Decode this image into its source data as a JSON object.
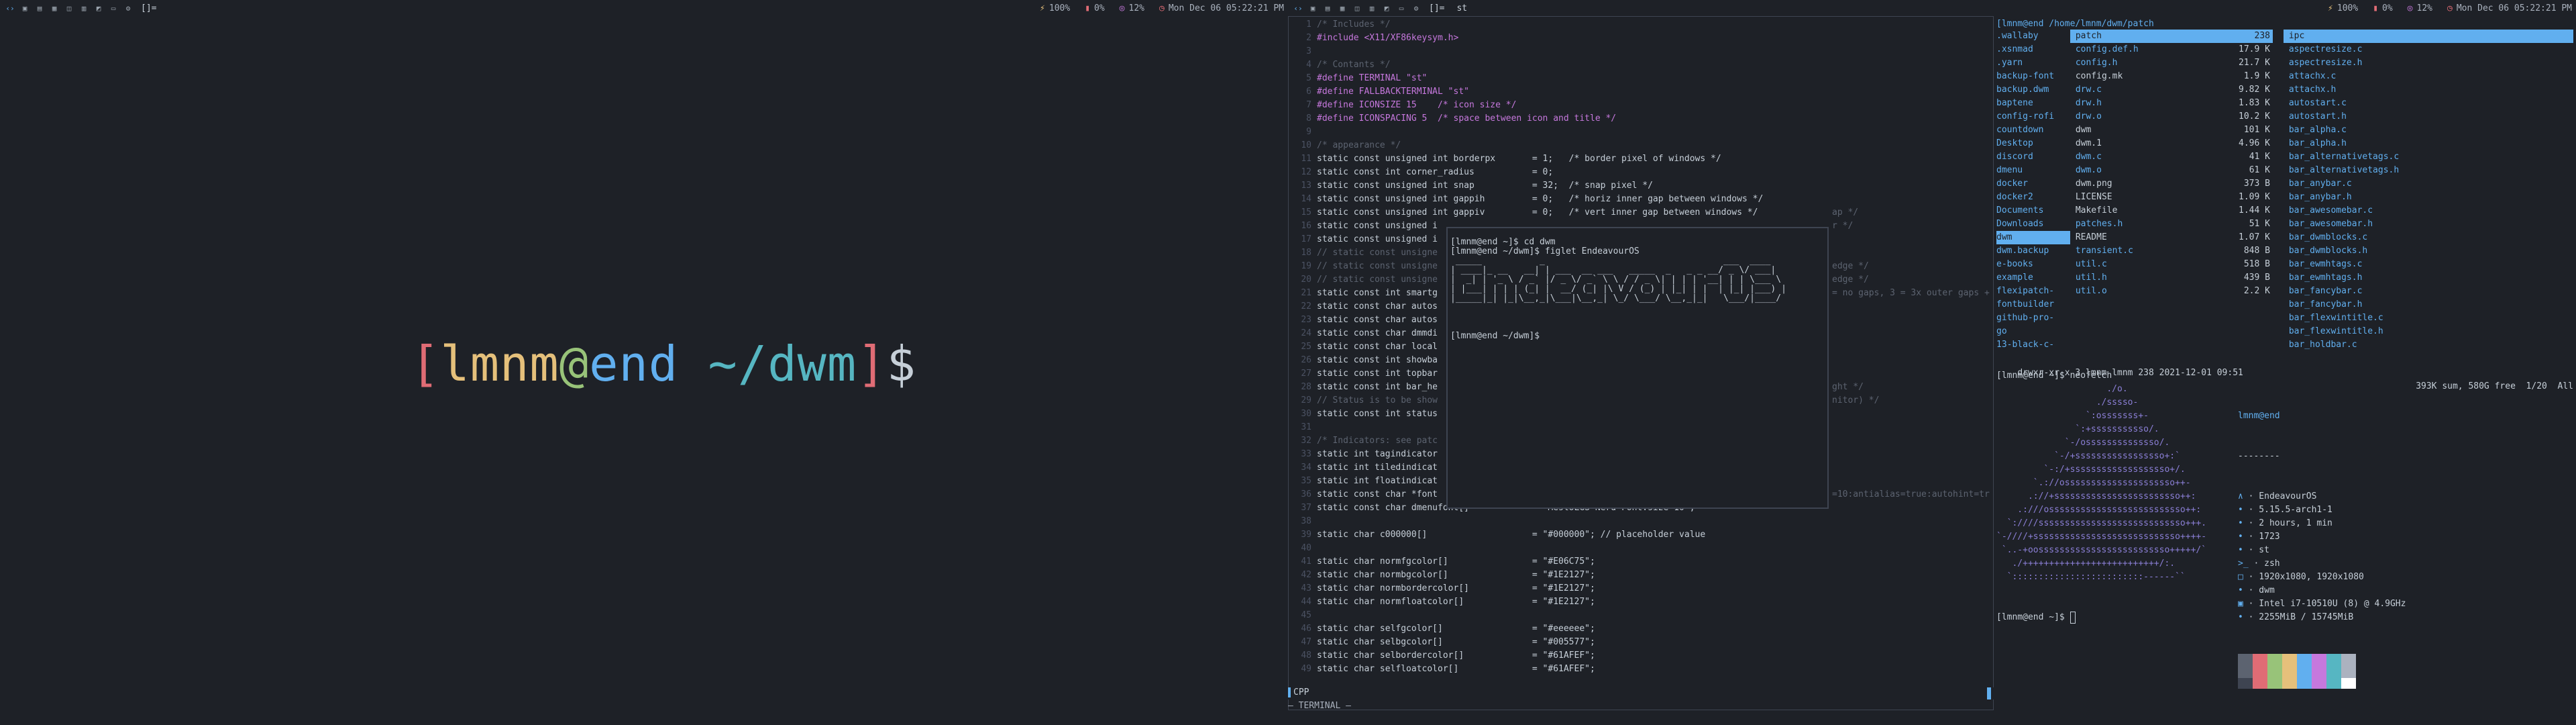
{
  "bar_left": {
    "layout": "[]=",
    "battery": "100%",
    "cpu": "0%",
    "mem": "12%",
    "clock": "Mon Dec 06 05:22:21 PM"
  },
  "bar_right": {
    "layout": "[]=",
    "title": "st",
    "battery": "100%",
    "cpu": "0%",
    "mem": "12%",
    "clock": "Mon Dec 06 05:22:21 PM"
  },
  "left_prompt": {
    "open": "[",
    "user": "lmnm",
    "at": "@",
    "host": "end",
    "path": "~/dwm",
    "close": "]",
    "sign": "$"
  },
  "editor": {
    "lines": [
      {
        "n": "1",
        "t": "/* Includes */",
        "k": "dim"
      },
      {
        "n": "2",
        "t": "#include <X11/XF86keysym.h>",
        "k": "m"
      },
      {
        "n": "3",
        "t": "",
        "k": "w"
      },
      {
        "n": "4",
        "t": "/* Contants */",
        "k": "dim"
      },
      {
        "n": "5",
        "t": "#define TERMINAL \"st\"",
        "k": "m"
      },
      {
        "n": "6",
        "t": "#define FALLBACKTERMINAL \"st\"",
        "k": "m"
      },
      {
        "n": "7",
        "t": "#define ICONSIZE 15    /* icon size */",
        "k": "m"
      },
      {
        "n": "8",
        "t": "#define ICONSPACING 5  /* space between icon and title */",
        "k": "m"
      },
      {
        "n": "9",
        "t": "",
        "k": "w"
      },
      {
        "n": "10",
        "t": "/* appearance */",
        "k": "dim"
      },
      {
        "n": "11",
        "t": "static const unsigned int borderpx       = 1;   /* border pixel of windows */",
        "k": "w"
      },
      {
        "n": "12",
        "t": "static const int corner_radius           = 0;",
        "k": "w"
      },
      {
        "n": "13",
        "t": "static const unsigned int snap           = 32;  /* snap pixel */",
        "k": "w"
      },
      {
        "n": "14",
        "t": "static const unsigned int gappih         = 0;   /* horiz inner gap between windows */",
        "k": "w"
      },
      {
        "n": "15",
        "t": "static const unsigned int gappiv         = 0;   /* vert inner gap between windows */",
        "k": "w"
      },
      {
        "n": "16",
        "t": "static const unsigned i",
        "k": "w"
      },
      {
        "n": "17",
        "t": "static const unsigned i",
        "k": "w"
      },
      {
        "n": "18",
        "t": "// static const unsigne",
        "k": "dim"
      },
      {
        "n": "19",
        "t": "// static const unsigne",
        "k": "dim"
      },
      {
        "n": "20",
        "t": "// static const unsigne",
        "k": "dim"
      },
      {
        "n": "21",
        "t": "static const int smartg",
        "k": "w"
      },
      {
        "n": "22",
        "t": "static const char autos",
        "k": "w"
      },
      {
        "n": "23",
        "t": "static const char autos",
        "k": "w"
      },
      {
        "n": "24",
        "t": "static const char dmmdi",
        "k": "w"
      },
      {
        "n": "25",
        "t": "static const char local",
        "k": "w"
      },
      {
        "n": "26",
        "t": "static const int showba",
        "k": "w"
      },
      {
        "n": "27",
        "t": "static const int topbar",
        "k": "w"
      },
      {
        "n": "28",
        "t": "static const int bar_he",
        "k": "w"
      },
      {
        "n": "29",
        "t": "// Status is to be show",
        "k": "dim"
      },
      {
        "n": "30",
        "t": "static const int status",
        "k": "w"
      },
      {
        "n": "31",
        "t": "",
        "k": "w"
      },
      {
        "n": "32",
        "t": "/* Indicators: see patc",
        "k": "dim"
      },
      {
        "n": "33",
        "t": "static int tagindicator",
        "k": "w"
      },
      {
        "n": "34",
        "t": "static int tiledindicat",
        "k": "w"
      },
      {
        "n": "35",
        "t": "static int floatindicat",
        "k": "w"
      },
      {
        "n": "36",
        "t": "static const char *font",
        "k": "w"
      },
      {
        "n": "37",
        "t": "static const char dmenufont[]            = \"MesloLGS Nerd Font:size=10\";",
        "k": "w"
      },
      {
        "n": "38",
        "t": "",
        "k": "w"
      },
      {
        "n": "39",
        "t": "static char c000000[]                    = \"#000000\"; // placeholder value",
        "k": "w"
      },
      {
        "n": "40",
        "t": "",
        "k": "w"
      },
      {
        "n": "41",
        "t": "static char normfgcolor[]                = \"#E06C75\";",
        "k": "w"
      },
      {
        "n": "42",
        "t": "static char normbgcolor[]                = \"#1E2127\";",
        "k": "w"
      },
      {
        "n": "43",
        "t": "static char normbordercolor[]            = \"#1E2127\";",
        "k": "w"
      },
      {
        "n": "44",
        "t": "static char normfloatcolor[]             = \"#1E2127\";",
        "k": "w"
      },
      {
        "n": "45",
        "t": "",
        "k": "w"
      },
      {
        "n": "46",
        "t": "static char selfgcolor[]                 = \"#eeeeee\";",
        "k": "w"
      },
      {
        "n": "47",
        "t": "static char selbgcolor[]                 = \"#005577\";",
        "k": "w"
      },
      {
        "n": "48",
        "t": "static char selbordercolor[]             = \"#61AFEF\";",
        "k": "w"
      },
      {
        "n": "49",
        "t": "static char selfloatcolor[]              = \"#61AFEF\";",
        "k": "w"
      }
    ],
    "overflow_right": [
      {
        "row": 15,
        "t": "ap */"
      },
      {
        "row": 16,
        "t": "r */"
      },
      {
        "row": 19,
        "t": "edge */"
      },
      {
        "row": 20,
        "t": "edge */"
      },
      {
        "row": 21,
        "t": "= no gaps, 3 = 3x outer gaps +"
      },
      {
        "row": 28,
        "t": "ght */"
      },
      {
        "row": 29,
        "t": "nitor) */"
      },
      {
        "row": 36,
        "t": "=10:antialias=true:autohint=tr"
      }
    ],
    "mode": "CPP",
    "terminal_label": "— TERMINAL —"
  },
  "float_term": {
    "lines": [
      "[lmnm@end ~]$ cd dwm",
      "[lmnm@end ~/dwm]$ figlet EndeavourOS",
      " _____           _                                  ___  ____  ",
      "| ____|_ __   __| | ___  __ ___   _____  _   _ _ __/ _ \\/ ___| ",
      "|  _| | '_ \\ / _` |/ _ \\/ _` \\ \\ / / _ \\| | | | '__| | | \\___ \\ ",
      "| |___| | | | (_| |  __/ (_| |\\ V / (_) | |_| | |  | |_| |___) |",
      "|_____|_| |_|\\__,_|\\___|\\__,_| \\_/ \\___/ \\__,_|_|   \\___/|____/ ",
      "",
      "[lmnm@end ~/dwm]$ "
    ]
  },
  "filemgr": {
    "path": "[lmnm@end /home/lmnm/dwm/patch",
    "col1": [
      ".wallaby",
      ".xsnmad",
      ".yarn",
      "backup-font",
      "backup.dwm",
      "baptene",
      "config-rofi",
      "countdown",
      "Desktop",
      "discord",
      "dmenu",
      "docker",
      "docker2",
      "Documents",
      "Downloads",
      "dwm",
      "dwm.backup",
      "e-books",
      "example",
      "flexipatch-",
      "fontbuilder",
      "github-pro-",
      "go",
      "13-black-c-"
    ],
    "col2": [
      {
        "name": "patch",
        "size": "238"
      },
      {
        "name": "config.def.h",
        "size": "17.9 K"
      },
      {
        "name": "config.h",
        "size": "21.7 K"
      },
      {
        "name": "config.mk",
        "size": "1.9 K"
      },
      {
        "name": "drw.c",
        "size": "9.82 K"
      },
      {
        "name": "drw.h",
        "size": "1.83 K"
      },
      {
        "name": "drw.o",
        "size": "10.2 K"
      },
      {
        "name": "dwm",
        "size": "101 K"
      },
      {
        "name": "dwm.1",
        "size": "4.96 K"
      },
      {
        "name": "dwm.c",
        "size": "41 K"
      },
      {
        "name": "dwm.o",
        "size": "61 K"
      },
      {
        "name": "dwm.png",
        "size": "373 B"
      },
      {
        "name": "LICENSE",
        "size": "1.09 K"
      },
      {
        "name": "Makefile",
        "size": "1.44 K"
      },
      {
        "name": "patches.h",
        "size": "51 K"
      },
      {
        "name": "README",
        "size": "1.07 K"
      },
      {
        "name": "transient.c",
        "size": "848 B"
      },
      {
        "name": "util.c",
        "size": "518 B"
      },
      {
        "name": "util.h",
        "size": "439 B"
      },
      {
        "name": "util.o",
        "size": "2.2 K"
      }
    ],
    "col3": [
      "ipc",
      "aspectresize.c",
      "aspectresize.h",
      "attachx.c",
      "attachx.h",
      "autostart.c",
      "autostart.h",
      "bar_alpha.c",
      "bar_alpha.h",
      "bar_alternativetags.c",
      "bar_alternativetags.h",
      "bar_anybar.c",
      "bar_anybar.h",
      "bar_awesomebar.c",
      "bar_awesomebar.h",
      "bar_dwmblocks.c",
      "bar_dwmblocks.h",
      "bar_ewmhtags.c",
      "bar_ewmhtags.h",
      "bar_fancybar.c",
      "bar_fancybar.h",
      "bar_flexwintitle.c",
      "bar_flexwintitle.h",
      "bar_holdbar.c"
    ],
    "statusline_left": "drwxr-xr-x 3 lmnm lmnm 238 2021-12-01 09:51",
    "statusline_right": "393K sum, 580G free  1/20  All"
  },
  "neofetch": {
    "prompt": "[lmnm@end ~]$ neofetch",
    "user": "lmnm@end",
    "sep": "--------",
    "info": [
      {
        "icon": "∧",
        "text": "EndeavourOS"
      },
      {
        "icon": "•",
        "text": "5.15.5-arch1-1"
      },
      {
        "icon": "•",
        "text": "2 hours, 1 min"
      },
      {
        "icon": "•",
        "text": "1723"
      },
      {
        "icon": "•",
        "text": "st"
      },
      {
        "icon": ">_",
        "text": "zsh"
      },
      {
        "icon": "□",
        "text": "1920x1080, 1920x1080"
      },
      {
        "icon": "•",
        "text": "dwm"
      },
      {
        "icon": "▣",
        "text": "Intel i7-10510U (8) @ 4.9GHz"
      },
      {
        "icon": "•",
        "text": "2255MiB / 15745MiB"
      }
    ],
    "art": [
      "                     ./o.",
      "                   ./sssso-",
      "                 `:osssssss+-",
      "               `:+sssssssssso/.",
      "             `-/ossssssssssssso/.",
      "           `-/+sssssssssssssssso+:`",
      "         `-:/+sssssssssssssssssso+/.",
      "       `.://osssssssssssssssssssso++-",
      "      .://+ssssssssssssssssssssssso++:",
      "    .:///ossssssssssssssssssssssssso++:",
      "  `:////ssssssssssssssssssssssssssso+++.",
      "`-////+ssssssssssssssssssssssssssso++++-",
      " `..-+oosssssssssssssssssssssssso+++++/`",
      "   ./++++++++++++++++++++++++++/:.",
      "  `:::::::::::::::::::::::::------``"
    ],
    "palette": [
      "#5c6370",
      "#e06c75",
      "#98c379",
      "#e5c07b",
      "#61afef",
      "#c678dd",
      "#56b6c2",
      "#abb2bf",
      "#3e4451",
      "#e06c75",
      "#98c379",
      "#e5c07b",
      "#61afef",
      "#c678dd",
      "#56b6c2",
      "#ffffff"
    ],
    "final_prompt": "[lmnm@end ~]$ "
  }
}
